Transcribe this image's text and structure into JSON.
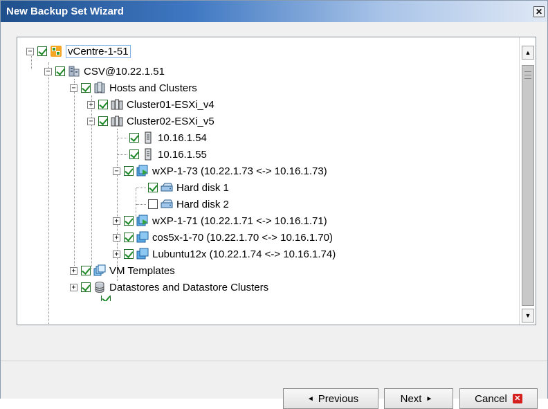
{
  "window": {
    "title": "New Backup Set Wizard",
    "close_glyph": "✕"
  },
  "tree": {
    "nodes": [
      {
        "label": "vCentre-1-51",
        "checked": true,
        "expander": "−",
        "icon": "vcenter-icon"
      },
      {
        "label": "CSV@10.22.1.51",
        "checked": true,
        "expander": "−",
        "icon": "datacenter-icon"
      },
      {
        "label": "Hosts and Clusters",
        "checked": true,
        "expander": "−",
        "icon": "hosts-clusters-icon"
      },
      {
        "label": "Cluster01-ESXi_v4",
        "checked": true,
        "expander": "+",
        "icon": "cluster-icon"
      },
      {
        "label": "Cluster02-ESXi_v5",
        "checked": true,
        "expander": "−",
        "icon": "cluster-icon"
      },
      {
        "label": "10.16.1.54",
        "checked": true,
        "expander": "",
        "icon": "host-icon"
      },
      {
        "label": "10.16.1.55",
        "checked": true,
        "expander": "",
        "icon": "host-icon"
      },
      {
        "label": "wXP-1-73 (10.22.1.73 <-> 10.16.1.73)",
        "checked": true,
        "expander": "−",
        "icon": "vm-running-icon"
      },
      {
        "label": "Hard disk 1",
        "checked": true,
        "expander": "",
        "icon": "hard-disk-icon"
      },
      {
        "label": "Hard disk 2",
        "checked": false,
        "expander": "",
        "icon": "hard-disk-icon"
      },
      {
        "label": "wXP-1-71 (10.22.1.71 <-> 10.16.1.71)",
        "checked": true,
        "expander": "+",
        "icon": "vm-running-icon"
      },
      {
        "label": "cos5x-1-70 (10.22.1.70 <-> 10.16.1.70)",
        "checked": true,
        "expander": "+",
        "icon": "vm-icon"
      },
      {
        "label": "Lubuntu12x (10.22.1.74 <-> 10.16.1.74)",
        "checked": true,
        "expander": "+",
        "icon": "vm-icon"
      },
      {
        "label": "VM Templates",
        "checked": true,
        "expander": "+",
        "icon": "vm-templates-icon"
      },
      {
        "label": "Datastores and Datastore Clusters",
        "checked": true,
        "expander": "+",
        "icon": "datastore-icon"
      }
    ]
  },
  "scrollbar": {
    "up_glyph": "▲",
    "down_glyph": "▼"
  },
  "buttons": {
    "previous_label": "Previous",
    "next_label": "Next",
    "cancel_label": "Cancel",
    "prev_arrow": "◄",
    "next_arrow": "►",
    "cancel_glyph": "✕"
  },
  "colors": {
    "check_green": "#1e8a27",
    "title_blue": "#1f4f8c",
    "cancel_red": "#d61f1f"
  }
}
